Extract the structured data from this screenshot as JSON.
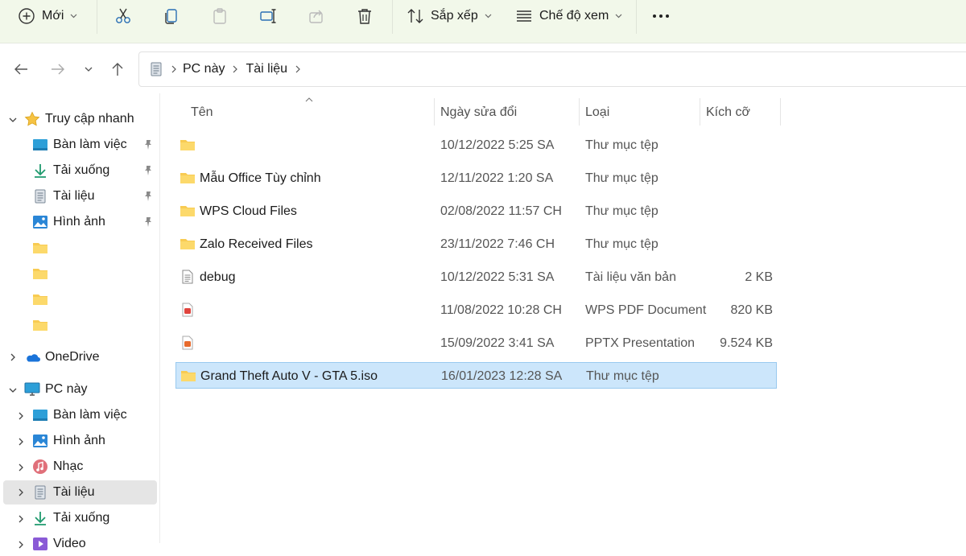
{
  "toolbar": {
    "new_label": "Mới",
    "sort_label": "Sắp xếp",
    "view_label": "Chế độ xem",
    "icons": [
      "cut-icon",
      "copy-icon",
      "paste-icon",
      "rename-icon",
      "share-icon",
      "delete-icon",
      "more-icon"
    ]
  },
  "address": {
    "crumbs": [
      "PC này",
      "Tài liệu"
    ]
  },
  "sidebar": {
    "quick_access": "Truy cập nhanh",
    "quick_items": [
      "Bàn làm việc",
      "Tải xuống",
      "Tài liệu",
      "Hình ảnh",
      "",
      "",
      "",
      ""
    ],
    "onedrive": "OneDrive",
    "this_pc": "PC này",
    "pc_items": [
      "Bàn làm việc",
      "Hình ảnh",
      "Nhạc",
      "Tài liệu",
      "Tải xuống",
      "Video"
    ]
  },
  "columns": {
    "name": "Tên",
    "date": "Ngày sửa đổi",
    "type": "Loại",
    "size": "Kích cỡ"
  },
  "files": [
    {
      "name": "",
      "date": "10/12/2022 5:25 SA",
      "type": "Thư mục tệp",
      "size": "",
      "icon": "folder-icon"
    },
    {
      "name": "Mẫu Office Tùy chỉnh",
      "date": "12/11/2022 1:20 SA",
      "type": "Thư mục tệp",
      "size": "",
      "icon": "folder-icon"
    },
    {
      "name": "WPS Cloud Files",
      "date": "02/08/2022 11:57 CH",
      "type": "Thư mục tệp",
      "size": "",
      "icon": "folder-icon"
    },
    {
      "name": "Zalo Received Files",
      "date": "23/11/2022 7:46 CH",
      "type": "Thư mục tệp",
      "size": "",
      "icon": "folder-icon"
    },
    {
      "name": "debug",
      "date": "10/12/2022 5:31 SA",
      "type": "Tài liệu văn bản",
      "size": "2 KB",
      "icon": "text-file-icon"
    },
    {
      "name": "",
      "date": "11/08/2022 10:28 CH",
      "type": "WPS PDF Document",
      "size": "820 KB",
      "icon": "pdf-file-icon"
    },
    {
      "name": "",
      "date": "15/09/2022 3:41 SA",
      "type": "PPTX Presentation",
      "size": "9.524 KB",
      "icon": "pptx-file-icon"
    },
    {
      "name": "Grand Theft Auto V - GTA 5.iso",
      "date": "16/01/2023 12:28 SA",
      "type": "Thư mục tệp",
      "size": "",
      "icon": "folder-icon",
      "selected": true
    }
  ],
  "colors": {
    "toolbar_bg": "#f2f8ea",
    "selection_bg": "#cce6fb",
    "folder": "#f8cb52"
  }
}
